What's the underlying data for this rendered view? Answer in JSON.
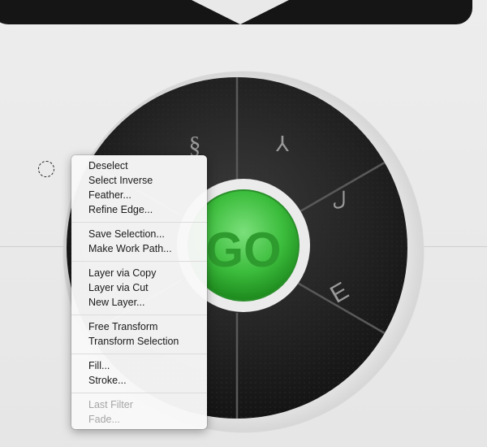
{
  "go_button": {
    "label": "GO",
    "color": "#3fb83f"
  },
  "wheel_segments": [
    {
      "icon": "section-icon",
      "glyph": "§"
    },
    {
      "icon": "figure-icon",
      "glyph": "⅄"
    },
    {
      "icon": "hook-icon",
      "glyph": "ل"
    },
    {
      "icon": "chair-icon",
      "glyph": "Ε"
    }
  ],
  "context_menu": {
    "groups": [
      [
        "Deselect",
        "Select Inverse",
        "Feather...",
        "Refine Edge..."
      ],
      [
        "Save Selection...",
        "Make Work Path..."
      ],
      [
        "Layer via Copy",
        "Layer via Cut",
        "New Layer..."
      ],
      [
        "Free Transform",
        "Transform Selection"
      ],
      [
        "Fill...",
        "Stroke..."
      ],
      [
        "Last Filter",
        "Fade..."
      ]
    ],
    "disabled_group": 5
  },
  "colors": {
    "led": "#e21d1d",
    "wheel": "#1e1e1e"
  }
}
